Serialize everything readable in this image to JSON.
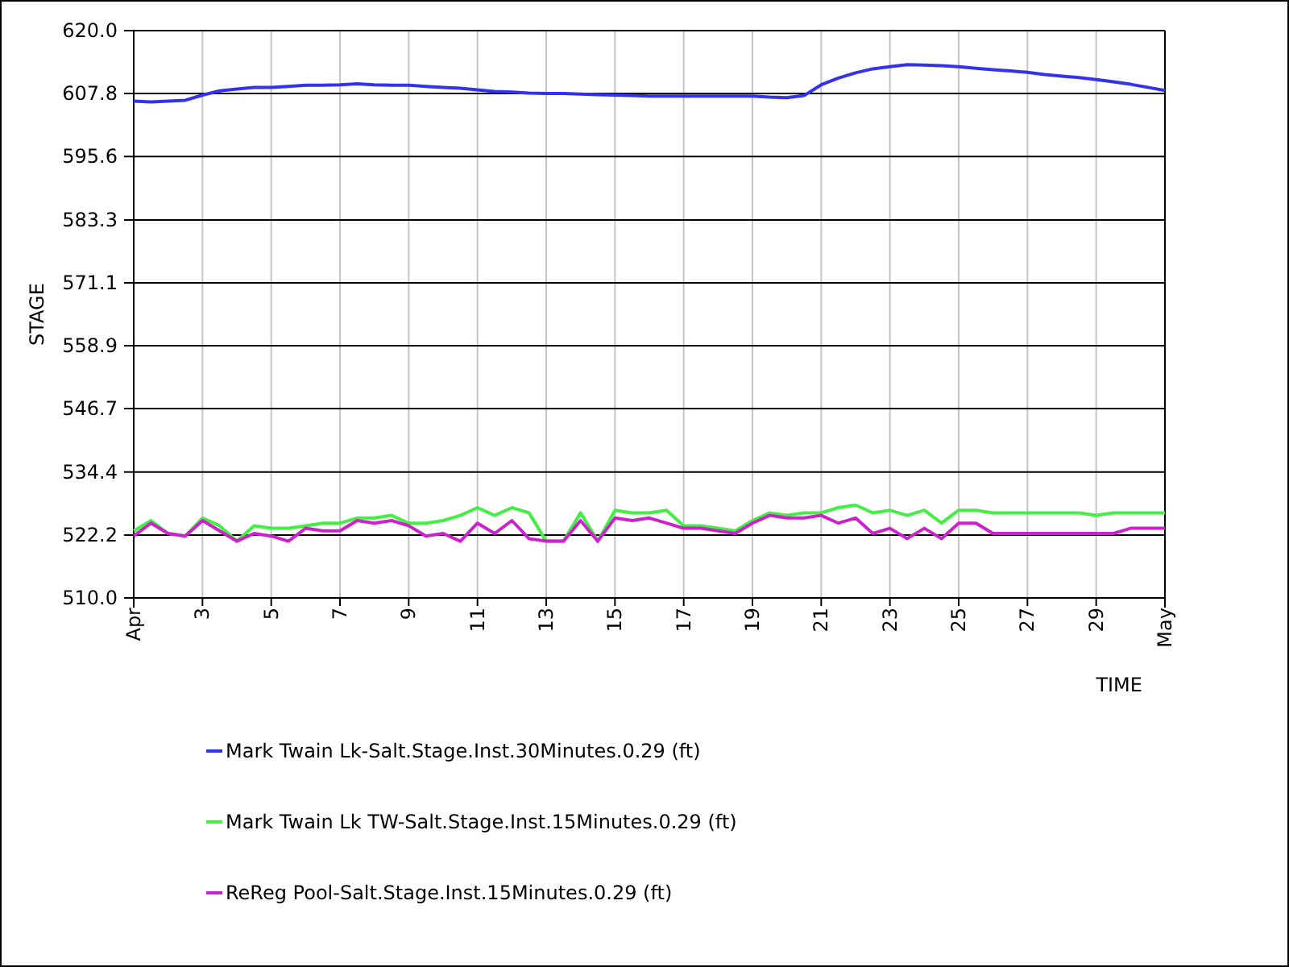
{
  "chart": {
    "chart_data": {
      "type": "line",
      "grid": true,
      "legend": "bottom",
      "xlabel": "TIME",
      "ylabel": "STAGE",
      "x": [
        1,
        1.5,
        2,
        2.5,
        3,
        3.5,
        4,
        4.5,
        5,
        5.5,
        6,
        6.5,
        7,
        7.5,
        8,
        8.5,
        9,
        9.5,
        10,
        10.5,
        11,
        11.5,
        12,
        12.5,
        13,
        13.5,
        14,
        14.5,
        15,
        15.5,
        16,
        16.5,
        17,
        17.5,
        18,
        18.5,
        19,
        19.5,
        20,
        20.5,
        21,
        21.5,
        22,
        22.5,
        23,
        23.5,
        24,
        24.5,
        25,
        25.5,
        26,
        26.5,
        27,
        27.5,
        28,
        28.5,
        29,
        29.5,
        30,
        30.5,
        31
      ],
      "xlim": [
        1,
        31
      ],
      "ylim": [
        510,
        620
      ],
      "xticks": [
        {
          "value": 1,
          "label": "Apr"
        },
        3,
        5,
        7,
        9,
        11,
        13,
        15,
        17,
        19,
        21,
        23,
        25,
        27,
        29,
        {
          "value": 31,
          "label": "May"
        }
      ],
      "yticks": [
        {
          "value": 510,
          "label": "510.0"
        },
        {
          "value": 522.2,
          "label": "522.2"
        },
        {
          "value": 534.4,
          "label": "534.4"
        },
        {
          "value": 546.7,
          "label": "546.7"
        },
        {
          "value": 558.9,
          "label": "558.9"
        },
        {
          "value": 571.1,
          "label": "571.1"
        },
        {
          "value": 583.3,
          "label": "583.3"
        },
        {
          "value": 595.6,
          "label": "595.6"
        },
        {
          "value": 607.8,
          "label": "607.8"
        },
        {
          "value": 620,
          "label": "620.0"
        }
      ],
      "series": [
        {
          "name": "Mark Twain Lk-Salt.Stage.Inst.30Minutes.0.29 (ft)",
          "color": "#3333ee",
          "values": [
            606.3,
            606.2,
            606.3,
            606.5,
            607.5,
            608.3,
            608.7,
            609,
            609,
            609.2,
            609.4,
            609.4,
            609.5,
            609.7,
            609.5,
            609.4,
            609.4,
            609.2,
            609,
            608.8,
            608.5,
            608.2,
            608.1,
            607.9,
            607.8,
            607.8,
            607.7,
            607.6,
            607.5,
            607.4,
            607.3,
            607.3,
            607.3,
            607.3,
            607.3,
            607.3,
            607.3,
            607.1,
            607,
            607.4,
            609.5,
            610.8,
            611.8,
            612.6,
            613,
            613.4,
            613.3,
            613.2,
            613,
            612.7,
            612.4,
            612.2,
            611.9,
            611.5,
            611.2,
            610.9,
            610.5,
            610.1,
            609.6,
            609,
            608.4
          ]
        },
        {
          "name": "Mark Twain Lk TW-Salt.Stage.Inst.15Minutes.0.29 (ft)",
          "color": "#44ee44",
          "values": [
            523,
            525,
            522.5,
            522,
            525.5,
            524,
            521,
            524,
            523.5,
            523.5,
            524,
            524.5,
            524.5,
            525.5,
            525.5,
            526,
            524.5,
            524.5,
            525,
            526,
            527.5,
            526,
            527.5,
            526.5,
            521,
            521,
            526.5,
            521,
            527,
            526.5,
            526.5,
            527,
            524,
            524,
            523.5,
            523,
            525,
            526.5,
            526,
            526.5,
            526.5,
            527.5,
            528,
            526.5,
            527,
            526,
            527,
            524.5,
            527,
            527,
            526.5,
            526.5,
            526.5,
            526.5,
            526.5,
            526.5,
            526,
            526.5,
            526.5,
            526.5,
            526.5
          ]
        },
        {
          "name": "ReReg Pool-Salt.Stage.Inst.15Minutes.0.29 (ft)",
          "color": "#cc22cc",
          "values": [
            522,
            524.5,
            522.5,
            522,
            525,
            523,
            521,
            522.5,
            522,
            521,
            523.5,
            523,
            523,
            525,
            524.5,
            525,
            524,
            522,
            522.5,
            521,
            524.5,
            522.5,
            525,
            521.5,
            521,
            521,
            525,
            521,
            525.5,
            525,
            525.5,
            524.5,
            523.5,
            523.5,
            523,
            522.5,
            524.5,
            526,
            525.5,
            525.5,
            526,
            524.5,
            525.5,
            522.5,
            523.5,
            521.5,
            523.5,
            521.5,
            524.5,
            524.5,
            522.5,
            522.5,
            522.5,
            522.5,
            522.5,
            522.5,
            522.5,
            522.5,
            523.5,
            523.5,
            523.5
          ]
        }
      ]
    }
  }
}
